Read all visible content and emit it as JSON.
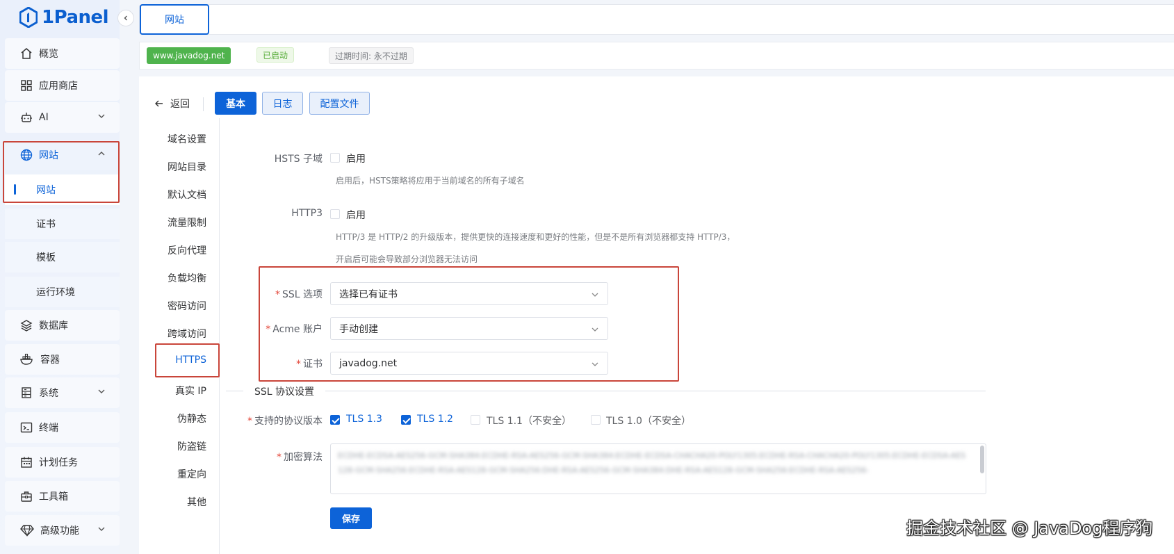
{
  "app": {
    "logo_text": "1Panel",
    "brand_color": "#0d63d8"
  },
  "sidebar": {
    "items": [
      {
        "label": "概览",
        "icon": "home-icon"
      },
      {
        "label": "应用商店",
        "icon": "grid-icon"
      },
      {
        "label": "AI",
        "icon": "robot-icon",
        "expandable": true
      },
      {
        "label": "网站",
        "icon": "globe-icon",
        "expandable": true,
        "expanded": true
      },
      {
        "label": "数据库",
        "icon": "layers-icon"
      },
      {
        "label": "容器",
        "icon": "docker-icon"
      },
      {
        "label": "系统",
        "icon": "server-icon",
        "expandable": true
      },
      {
        "label": "终端",
        "icon": "terminal-icon"
      },
      {
        "label": "计划任务",
        "icon": "calendar-icon"
      },
      {
        "label": "工具箱",
        "icon": "toolbox-icon"
      },
      {
        "label": "高级功能",
        "icon": "diamond-icon",
        "expandable": true
      }
    ],
    "website_children": [
      "网站",
      "证书",
      "模板",
      "运行环境"
    ],
    "active_child": "网站"
  },
  "tabs": {
    "active": "网站"
  },
  "site_info": {
    "domain": "www.javadog.net",
    "status": "已启动",
    "expire": "过期时间: 永不过期"
  },
  "toolbar": {
    "back_label": "返回",
    "buttons": [
      "基本",
      "日志",
      "配置文件"
    ],
    "active_button": "基本"
  },
  "subnav": {
    "items": [
      "域名设置",
      "网站目录",
      "默认文档",
      "流量限制",
      "反向代理",
      "负载均衡",
      "密码访问",
      "跨域访问",
      "HTTPS",
      "真实 IP",
      "伪静态",
      "防盗链",
      "重定向",
      "其他"
    ],
    "active": "HTTPS"
  },
  "form": {
    "hsts_subdomain": {
      "label": "HSTS 子域",
      "checkbox_label": "启用",
      "checked": false,
      "help": "启用后，HSTS策略将应用于当前域名的所有子域名"
    },
    "http3": {
      "label": "HTTP3",
      "checkbox_label": "启用",
      "checked": false,
      "help_line1": "HTTP/3 是 HTTP/2 的升级版本，提供更快的连接速度和更好的性能，但是不是所有浏览器都支持 HTTP/3，",
      "help_line2": "开启后可能会导致部分浏览器无法访问"
    },
    "ssl_option": {
      "label": "SSL 选项",
      "value": "选择已有证书"
    },
    "acme_account": {
      "label": "Acme 账户",
      "value": "手动创建"
    },
    "certificate": {
      "label": "证书",
      "value": "javadog.net"
    },
    "ssl_protocol_section": "SSL 协议设置",
    "protocols": {
      "label": "支持的协议版本",
      "options": [
        {
          "label": "TLS 1.3",
          "checked": true
        },
        {
          "label": "TLS 1.2",
          "checked": true
        },
        {
          "label": "TLS 1.1（不安全）",
          "checked": false
        },
        {
          "label": "TLS 1.0（不安全）",
          "checked": false
        }
      ]
    },
    "ciphers": {
      "label": "加密算法",
      "value": "ECDHE-ECDSA-AES256-GCM-SHA384:ECDHE-RSA-AES256-GCM-SHA384:ECDHE-ECDSA-CHACHA20-POLY1305:ECDHE-RSA-CHACHA20-POLY1305:ECDHE-ECDSA-AES128-GCM-SHA256:ECDHE-RSA-AES128-GCM-SHA256:DHE-RSA-AES256-GCM-SHA384:DHE-RSA-AES128-GCM-SHA256:ECDHE-RSA-AES256-"
    },
    "save_label": "保存"
  },
  "watermark": "掘金技术社区 @ JavaDog程序狗"
}
